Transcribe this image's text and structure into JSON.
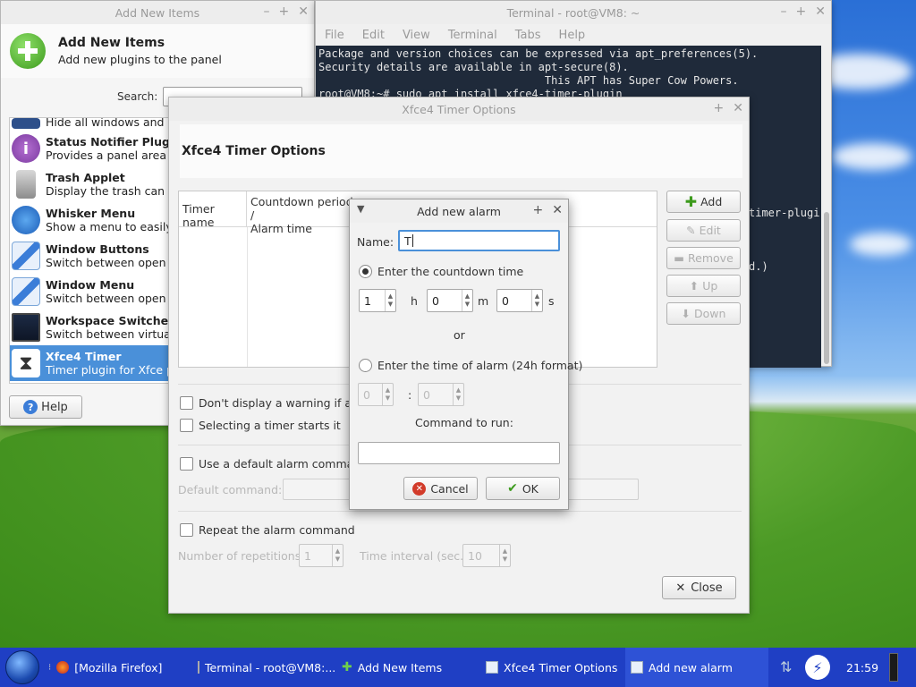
{
  "add_new_items": {
    "title": "Add New Items",
    "header_title": "Add New Items",
    "header_subtitle": "Add new plugins to the panel",
    "search_label": "Search:",
    "search_value": "",
    "plugins": [
      {
        "name": "",
        "desc": "Hide all windows and sho"
      },
      {
        "name": "Status Notifier Plugin",
        "desc": "Provides a panel area fo"
      },
      {
        "name": "Trash Applet",
        "desc": "Display the trash can"
      },
      {
        "name": "Whisker Menu",
        "desc": "Show a menu to easily ac"
      },
      {
        "name": "Window Buttons",
        "desc": "Switch between open win"
      },
      {
        "name": "Window Menu",
        "desc": "Switch between open win"
      },
      {
        "name": "Workspace Switcher",
        "desc": "Switch between virtual de"
      },
      {
        "name": "Xfce4 Timer",
        "desc": "Timer plugin for Xfce par"
      }
    ],
    "help_label": "Help"
  },
  "terminal": {
    "title": "Terminal - root@VM8: ~",
    "menu": [
      "File",
      "Edit",
      "View",
      "Terminal",
      "Tabs",
      "Help"
    ],
    "lines": [
      "Package and version choices can be expressed via apt_preferences(5).",
      "Security details are available in apt-secure(8).",
      "                                   This APT has Super Cow Powers.",
      "root@VM8:~# sudo apt install xfce4-timer-plugin"
    ],
    "partial_1": "timer-plugi",
    "partial_2": "d.)"
  },
  "timer_options": {
    "title": "Xfce4 Timer Options",
    "header": "Xfce4 Timer Options",
    "col_timer_name": "Timer name",
    "col_countdown": "Countdown period /\nAlarm time",
    "btn_add": "Add",
    "btn_edit": "Edit",
    "btn_remove": "Remove",
    "btn_up": "Up",
    "btn_down": "Down",
    "opt_no_warning": "Don't display a warning  if an a",
    "opt_selecting": "Selecting a timer starts it",
    "opt_default_cmd": "Use a default alarm command",
    "default_cmd_label": "Default command:",
    "opt_repeat": "Repeat the alarm command",
    "repetitions_label": "Number of repetitions",
    "repetitions_value": "1",
    "interval_label": "Time interval (sec.)",
    "interval_value": "10",
    "close_label": "Close"
  },
  "alarm_dialog": {
    "title": "Add new alarm",
    "name_label": "Name:",
    "name_value": "T",
    "countdown_label": "Enter the countdown time",
    "hours": "1",
    "h": "h",
    "minutes": "0",
    "m": "m",
    "seconds": "0",
    "s": "s",
    "or": "or",
    "alarm_time_label": "Enter the time of alarm (24h format)",
    "alarm_hour": "0",
    "colon": ":",
    "alarm_min": "0",
    "command_label": "Command to run:",
    "command_value": "",
    "cancel_label": "Cancel",
    "ok_label": "OK"
  },
  "taskbar": {
    "tasks": [
      {
        "label": "[Mozilla Firefox]"
      },
      {
        "label": "Terminal - root@VM8:..."
      },
      {
        "label": "Add New Items"
      },
      {
        "label": "Xfce4 Timer Options"
      },
      {
        "label": "Add new alarm"
      }
    ],
    "clock": "21:59"
  },
  "colors": {
    "selection": "#4a90d9",
    "taskbar": "#1f3fc4",
    "terminal_bg": "#1f2a3a"
  }
}
